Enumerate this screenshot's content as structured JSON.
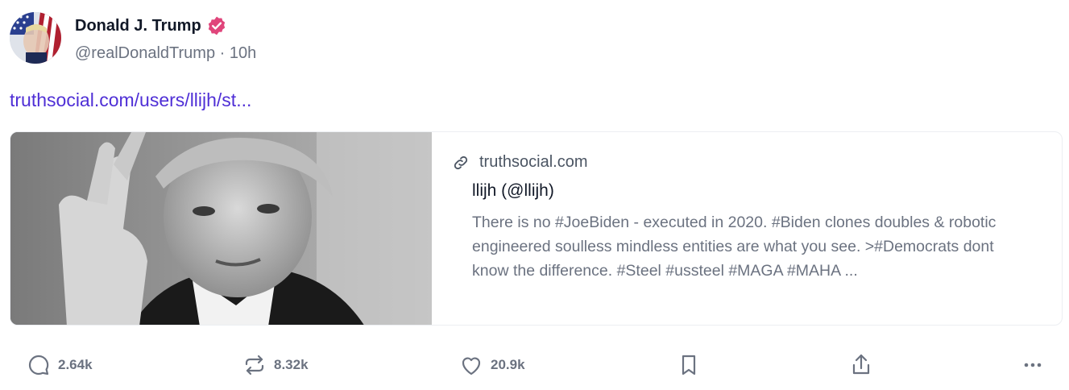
{
  "author": {
    "name": "Donald J. Trump",
    "handle": "@realDonaldTrump",
    "separator": "·",
    "time": "10h",
    "verified_color": "#e0457b",
    "avatar_icon": "avatar-flag-portrait"
  },
  "post": {
    "link_text": "truthsocial.com/users/llijh/st...",
    "link_color": "#4f2fd6"
  },
  "preview": {
    "image_icon": "photo-peace-sign-portrait",
    "domain": "truthsocial.com",
    "title": "llijh (@llijh)",
    "description": "There is no #JoeBiden - executed in 2020. #Biden clones doubles & robotic engineered soulless mindless entities are what you see. >#Democrats dont know the difference. #Steel #ussteel #MAGA #MAHA ..."
  },
  "actions": {
    "reply_count": "2.64k",
    "retruth_count": "8.32k",
    "like_count": "20.9k",
    "icons": [
      "comment-icon",
      "retruth-icon",
      "heart-icon",
      "bookmark-icon",
      "share-icon",
      "more-icon"
    ]
  }
}
